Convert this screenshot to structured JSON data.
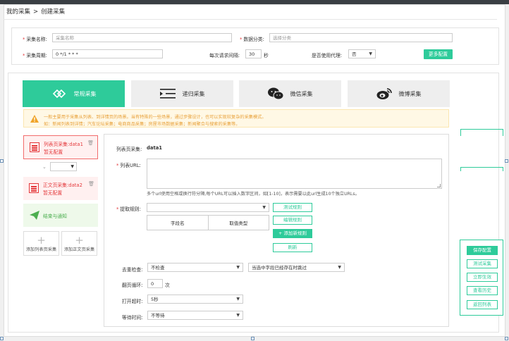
{
  "breadcrumb": {
    "root": "我的采集",
    "separator": ">",
    "current": "创建采集"
  },
  "basic": {
    "name_label": "采集名称:",
    "name_placeholder": "采集名称",
    "category_label": "数据分类:",
    "category_placeholder": "选择分类",
    "cycle_label": "采集周期:",
    "cycle_value": "0 */1 * * *",
    "interval_label": "每次请求间隔:",
    "interval_value": "30",
    "interval_unit": "秒",
    "proxy_label": "是否使用代理:",
    "proxy_value": "否",
    "more_button": "更多配置"
  },
  "tabs": [
    {
      "label": "常规采集",
      "icon": "network-icon",
      "active": true
    },
    {
      "label": "递归采集",
      "icon": "indent-list-icon",
      "active": false
    },
    {
      "label": "微信采集",
      "icon": "wechat-icon",
      "active": false
    },
    {
      "label": "微博采集",
      "icon": "weibo-icon",
      "active": false
    }
  ],
  "notice": {
    "line1": "一般主要用于采集从列表、到详情页的场景。当有特殊的一些场景，通过步骤设计，也可以实现较复杂的采集模式。",
    "line2": "如：新闻列表到详情；汽车论坛采集；电商商品采集；房屋市场数据采集；新闻聚合与搜索的采集等。"
  },
  "steps": [
    {
      "name": "列表页采集:data1",
      "status": "暂无配置"
    },
    {
      "name": "正文页采集:data2",
      "status": "暂无配置"
    },
    {
      "name": "结束与通知"
    }
  ],
  "add_buttons": {
    "list": "添加列表页采集",
    "content": "添加正文页采集"
  },
  "form": {
    "title_label": "列表页采集:",
    "title_value": "data1",
    "url_label": "列表URL:",
    "url_hint": "多个url使用空格或换行符分隔,每个URL可以插入数字区间，如[1-10]，表示需要以此url生成10个独立URLs。",
    "rule_label": "提取规则:",
    "table_headers": [
      "字段名",
      "取值类型"
    ],
    "test_rule": "测试规则",
    "edit_rule": "编辑规则",
    "add_rule": "+ 添加新规则",
    "refresh": "刷新",
    "dedup_label": "去重检查:",
    "dedup_value": "不检查",
    "dedup_mode": "当选中字段已经存在时跳过",
    "loop_label": "翻页循环:",
    "loop_value": "0",
    "loop_unit": "次",
    "timeout_label": "打开超时:",
    "timeout_value": "5秒",
    "wait_label": "等待时间:",
    "wait_value": "不等待"
  },
  "actions": [
    "保存配置",
    "测试采集",
    "立即生效",
    "查看历史",
    "返回列表"
  ]
}
